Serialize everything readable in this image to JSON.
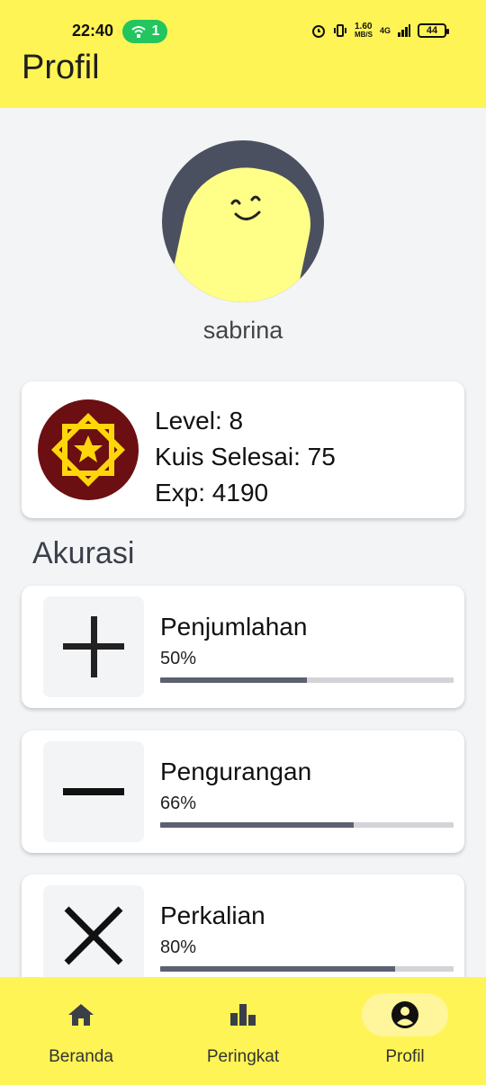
{
  "status_bar": {
    "time": "22:40",
    "hotspot_count": "1",
    "speed_value": "1.60",
    "speed_unit": "MB/S",
    "network": "4G",
    "battery": "44"
  },
  "header": {
    "title": "Profil"
  },
  "profile": {
    "username": "sabrina"
  },
  "level_card": {
    "level": "Level: 8",
    "quizzes": "Kuis Selesai: 75",
    "exp": "Exp: 4190"
  },
  "accuracy": {
    "title": "Akurasi",
    "items": [
      {
        "name": "Penjumlahan",
        "percent_label": "50%",
        "percent": 50,
        "icon": "plus-icon"
      },
      {
        "name": "Pengurangan",
        "percent_label": "66%",
        "percent": 66,
        "icon": "minus-icon"
      },
      {
        "name": "Perkalian",
        "percent_label": "80%",
        "percent": 80,
        "icon": "times-icon"
      }
    ]
  },
  "bottom_nav": {
    "items": [
      {
        "label": "Beranda",
        "icon": "home-icon"
      },
      {
        "label": "Peringkat",
        "icon": "bar-chart-icon"
      },
      {
        "label": "Profil",
        "icon": "account-circle-icon",
        "active": true
      }
    ]
  },
  "colors": {
    "accent_yellow": "#fff455",
    "badge_maroon": "#6b0f12",
    "badge_star": "#ffd60a",
    "progress_fill": "#5b6170"
  }
}
